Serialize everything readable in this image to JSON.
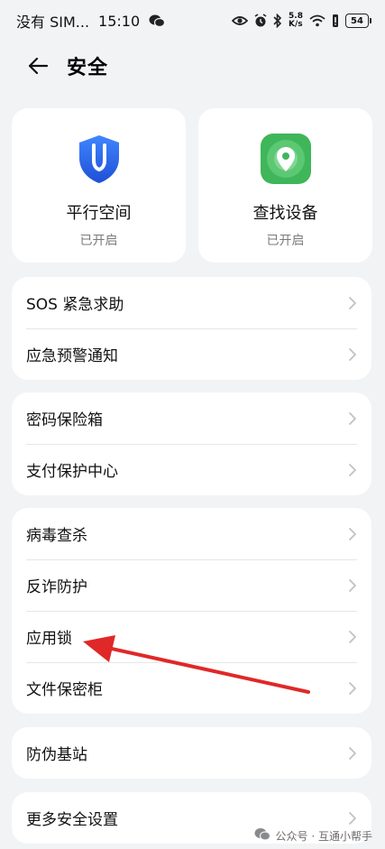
{
  "status_bar": {
    "carrier": "没有 SIM...",
    "time": "15:10",
    "net_speed_value": "5.8",
    "net_speed_unit": "K/s",
    "battery": "54",
    "icons": [
      "wechat-icon",
      "eye-icon",
      "alarm-icon",
      "bluetooth-icon",
      "wifi-icon",
      "vibrate-icon",
      "battery-icon"
    ]
  },
  "header": {
    "title": "安全",
    "back_icon": "back-arrow-icon"
  },
  "tiles": [
    {
      "title": "平行空间",
      "status": "已开启",
      "icon": "shield-icon",
      "color": "#2a63e6"
    },
    {
      "title": "查找设备",
      "status": "已开启",
      "icon": "location-pin-icon",
      "color": "#3fb65a"
    }
  ],
  "groups": [
    {
      "items": [
        {
          "label": "SOS 紧急求助"
        },
        {
          "label": "应急预警通知"
        }
      ]
    },
    {
      "items": [
        {
          "label": "密码保险箱"
        },
        {
          "label": "支付保护中心"
        }
      ]
    },
    {
      "items": [
        {
          "label": "病毒查杀"
        },
        {
          "label": "反诈防护"
        },
        {
          "label": "应用锁"
        },
        {
          "label": "文件保密柜"
        }
      ]
    },
    {
      "items": [
        {
          "label": "防伪基站"
        }
      ]
    },
    {
      "items": [
        {
          "label": "更多安全设置"
        }
      ]
    }
  ],
  "annotation": {
    "arrow_color": "#e02828",
    "points_to": "应用锁"
  },
  "watermark": {
    "text": "公众号 · 互通小帮手"
  }
}
